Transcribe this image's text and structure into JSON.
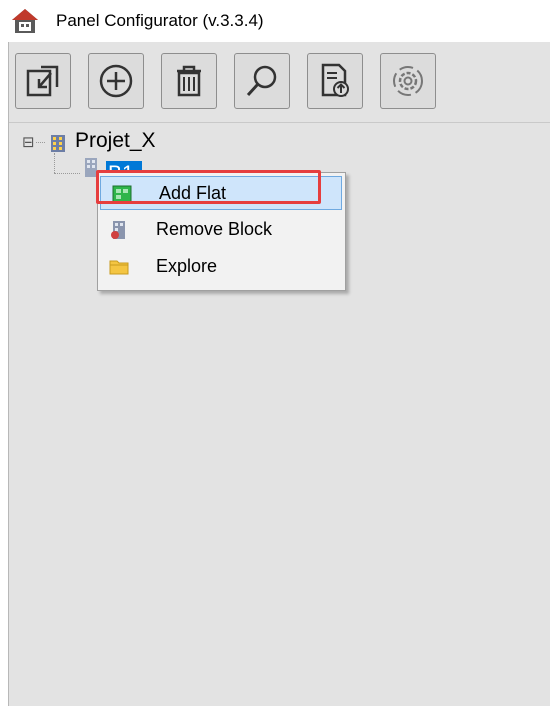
{
  "window": {
    "title": "Panel Configurator (v.3.3.4)",
    "app_icon": "house-icon"
  },
  "toolbar": {
    "buttons": [
      {
        "name": "import-button",
        "icon": "import-icon"
      },
      {
        "name": "add-button",
        "icon": "plus-circle-icon"
      },
      {
        "name": "delete-button",
        "icon": "trash-icon"
      },
      {
        "name": "search-button",
        "icon": "magnifier-icon"
      },
      {
        "name": "export-button",
        "icon": "document-upload-icon"
      },
      {
        "name": "settings-button",
        "icon": "gear-icon"
      }
    ]
  },
  "tree": {
    "root": {
      "label": "Projet_X",
      "expander": "⊟"
    },
    "child": {
      "label": "B1",
      "selected": true
    }
  },
  "context_menu": {
    "items": [
      {
        "label": "Add Flat",
        "icon": "add-flat-icon",
        "highlighted": true
      },
      {
        "label": "Remove Block",
        "icon": "remove-block-icon"
      },
      {
        "label": "Explore",
        "icon": "folder-icon"
      }
    ]
  },
  "colors": {
    "selection": "#0078d7",
    "highlight_border": "#e63e3e",
    "menu_hover": "#cfe5fb"
  }
}
